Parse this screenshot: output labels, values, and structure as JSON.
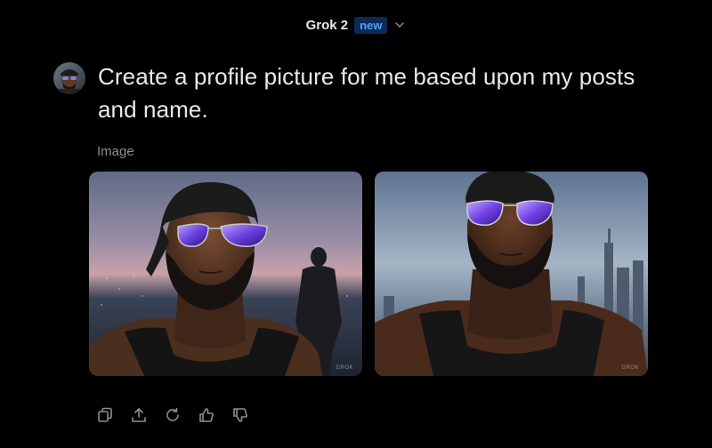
{
  "header": {
    "model_name": "Grok 2",
    "model_badge": "new",
    "dropdown_icon": "chevron-down-icon"
  },
  "message": {
    "prompt": "Create a profile picture for me based upon my posts and name.",
    "avatar_icon": "user-avatar"
  },
  "response": {
    "label": "Image",
    "images": [
      {
        "watermark": "GROK"
      },
      {
        "watermark": "GROK"
      }
    ]
  },
  "actions": [
    {
      "icon": "copy-icon"
    },
    {
      "icon": "share-icon"
    },
    {
      "icon": "regenerate-icon"
    },
    {
      "icon": "thumbs-up-icon"
    },
    {
      "icon": "thumbs-down-icon"
    }
  ],
  "colors": {
    "background": "#000000",
    "text": "#e7e9ea",
    "muted": "#8b8f94",
    "badge_text": "#4ea2ff",
    "badge_bg": "#0d2a54"
  }
}
